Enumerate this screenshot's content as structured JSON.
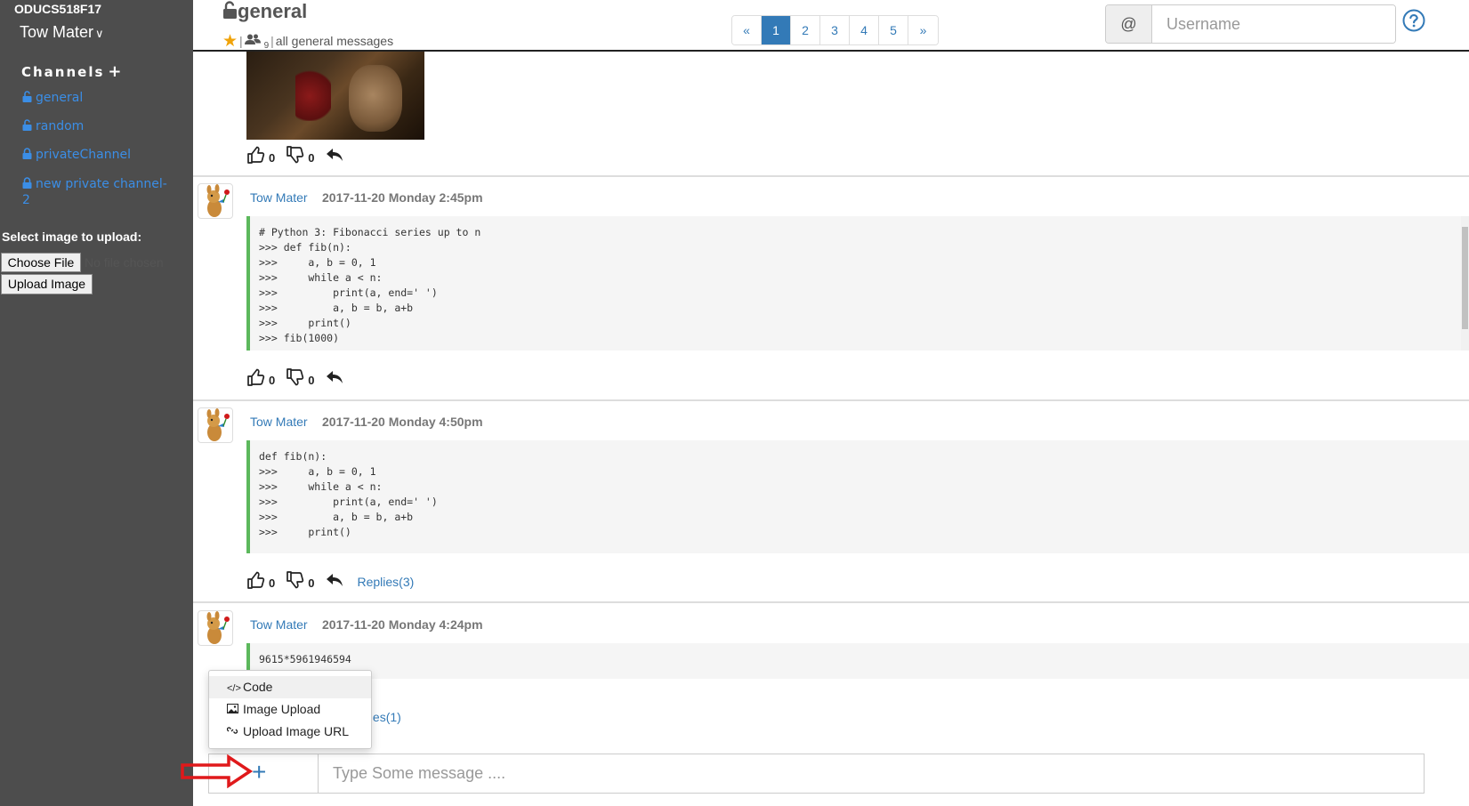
{
  "sidebar": {
    "workspace": "ODUCS518F17",
    "user": "Tow Mater",
    "channels_heading": "Channels",
    "channels": [
      {
        "label": "general",
        "locked": false
      },
      {
        "label": "random",
        "locked": false
      },
      {
        "label": "privateChannel",
        "locked": true
      },
      {
        "label": "new private channel-2",
        "locked": true
      }
    ],
    "upload_label": "Select image to upload:",
    "choose_file": "Choose File",
    "no_file": "No file chosen",
    "upload_button": "Upload Image"
  },
  "header": {
    "channel": "general",
    "member_count": "9",
    "purpose": "all general messages",
    "pagination": [
      "«",
      "1",
      "2",
      "3",
      "4",
      "5",
      "»"
    ],
    "active_page": "1",
    "username_prefix": "@",
    "username_placeholder": "Username"
  },
  "messages": [
    {
      "likes": "0",
      "dislikes": "0"
    },
    {
      "author": "Tow Mater",
      "timestamp": "2017-11-20 Monday 2:45pm",
      "code": [
        "# Python 3: Fibonacci series up to n",
        ">>> def fib(n):",
        ">>>     a, b = 0, 1",
        ">>>     while a < n:",
        ">>>         print(a, end=' ')",
        ">>>         a, b = b, a+b",
        ">>>     print()",
        ">>> fib(1000)"
      ],
      "likes": "0",
      "dislikes": "0"
    },
    {
      "author": "Tow Mater",
      "timestamp": "2017-11-20 Monday 4:50pm",
      "code": [
        "def fib(n):",
        ">>>     a, b = 0, 1",
        ">>>     while a < n:",
        ">>>         print(a, end=' ')",
        ">>>         a, b = b, a+b",
        ">>>     print()"
      ],
      "likes": "0",
      "dislikes": "0",
      "replies": "Replies(3)"
    },
    {
      "author": "Tow Mater",
      "timestamp": "2017-11-20 Monday 4:24pm",
      "code": [
        "9615*5961946594"
      ],
      "replies": "Replies(1)"
    }
  ],
  "attach_menu": {
    "items": [
      {
        "label": "Code",
        "icon": "code-icon"
      },
      {
        "label": "Image Upload",
        "icon": "image-icon"
      },
      {
        "label": "Upload Image URL",
        "icon": "link-icon"
      }
    ]
  },
  "composer": {
    "placeholder": "Type Some message ...."
  },
  "colors": {
    "sidebar_bg": "#4d4d4d",
    "link": "#337ab7",
    "code_border": "#5cb85c",
    "star": "#f0a30a",
    "annotation_arrow": "#e0191b"
  }
}
